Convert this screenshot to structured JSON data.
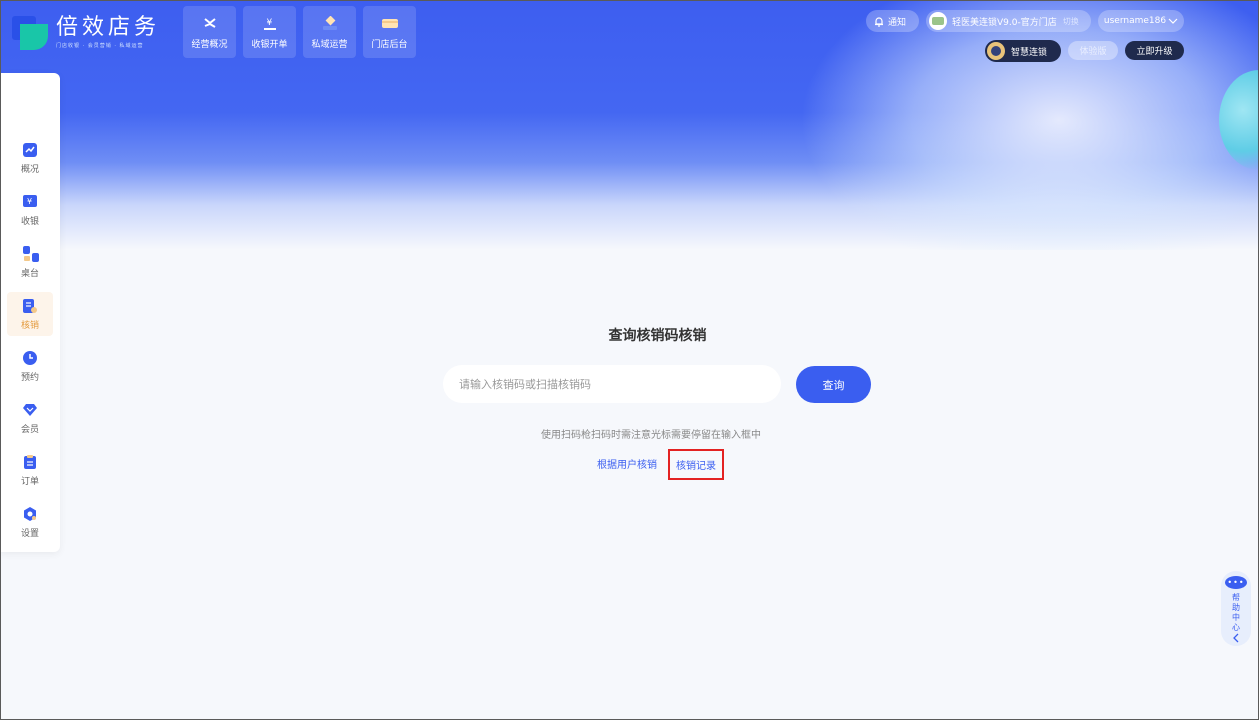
{
  "brand": {
    "title": "倍效店务",
    "subtitle": "门店收银 · 会员营销 · 私域运营"
  },
  "topnav": [
    {
      "label": "经营概况",
      "icon": "chart-trend-icon"
    },
    {
      "label": "收银开单",
      "icon": "cashier-icon"
    },
    {
      "label": "私域运营",
      "icon": "diamond-icon"
    },
    {
      "label": "门店后台",
      "icon": "store-card-icon"
    }
  ],
  "header": {
    "notice": "通知",
    "store_name": "轻医美连锁V9.0-官方门店",
    "switch_label": "切换",
    "username": "username186",
    "smart_chain": "智慧连锁",
    "trial": "体验版",
    "upgrade": "立即升级"
  },
  "sidebar": [
    {
      "label": "概况",
      "icon": "overview-icon",
      "active": false
    },
    {
      "label": "收银",
      "icon": "cashier-icon",
      "active": false
    },
    {
      "label": "桌台",
      "icon": "table-icon",
      "active": false
    },
    {
      "label": "核销",
      "icon": "verify-icon",
      "active": true
    },
    {
      "label": "预约",
      "icon": "clock-icon",
      "active": false
    },
    {
      "label": "会员",
      "icon": "member-diamond-icon",
      "active": false
    },
    {
      "label": "订单",
      "icon": "order-icon",
      "active": false
    },
    {
      "label": "设置",
      "icon": "settings-icon",
      "active": false
    }
  ],
  "main": {
    "title": "查询核销码核销",
    "search_placeholder": "请输入核销码或扫描核销码",
    "search_value": "",
    "query_button": "查询",
    "hint": "使用扫码枪扫码时需注意光标需要停留在输入框中",
    "link_by_user": "根据用户核销",
    "link_records": "核销记录"
  },
  "help": {
    "label": "帮助中心",
    "icon_text": "•••"
  },
  "colors": {
    "primary": "#3a5ef0",
    "header_dark": "#1f2a4d",
    "active_accent": "#e49a3c",
    "highlight_box": "#e32222"
  }
}
